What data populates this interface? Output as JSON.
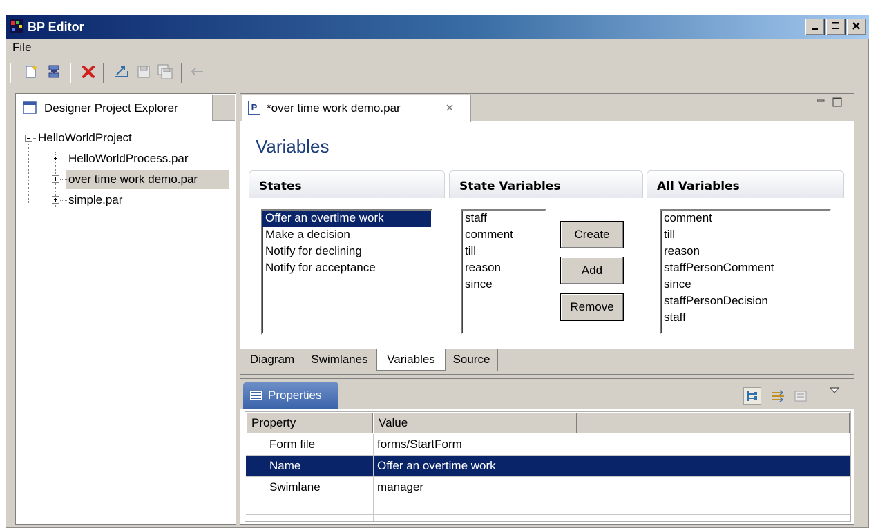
{
  "app": {
    "title": "BP Editor"
  },
  "menu": {
    "file": "File"
  },
  "toolbar": {
    "icons": [
      "new-icon",
      "deploy-icon",
      "delete-icon",
      "export-icon",
      "save-icon",
      "save-all-icon",
      "back-arrow-icon"
    ]
  },
  "explorer": {
    "tab_label": "Designer Project Explorer",
    "tree": {
      "root": "HelloWorldProject",
      "children": [
        "HelloWorldProcess.par",
        "over time work demo.par",
        "simple.par"
      ]
    }
  },
  "editor": {
    "tab_label": "*over time work demo.par",
    "heading": "Variables",
    "sections": {
      "states": "States",
      "state_variables": "State Variables",
      "all_variables": "All Variables"
    },
    "states": [
      "Offer an overtime work",
      "Make a decision",
      "Notify for declining",
      "Notify for acceptance"
    ],
    "selected_state": "Offer an overtime work",
    "state_variables": [
      "staff",
      "comment",
      "till",
      "reason",
      "since"
    ],
    "all_variables": [
      "comment",
      "till",
      "reason",
      "staffPersonComment",
      "since",
      "staffPersonDecision",
      "staff"
    ],
    "buttons": {
      "create": "Create",
      "add": "Add",
      "remove": "Remove"
    },
    "bottom_tabs": [
      "Diagram",
      "Swimlanes",
      "Variables",
      "Source"
    ],
    "active_bottom_tab": "Variables"
  },
  "properties": {
    "tab_label": "Properties",
    "columns": [
      "Property",
      "Value"
    ],
    "rows": [
      {
        "property": "Form file",
        "value": "forms/StartForm"
      },
      {
        "property": "Name",
        "value": "Offer an overtime work"
      },
      {
        "property": "Swimlane",
        "value": "manager"
      }
    ],
    "selected_row": "Name"
  },
  "colors": {
    "selection": "#0a246a",
    "title_gradient_start": "#0a246a",
    "heading": "#1a3c7a",
    "chrome": "#d4d0c8"
  }
}
